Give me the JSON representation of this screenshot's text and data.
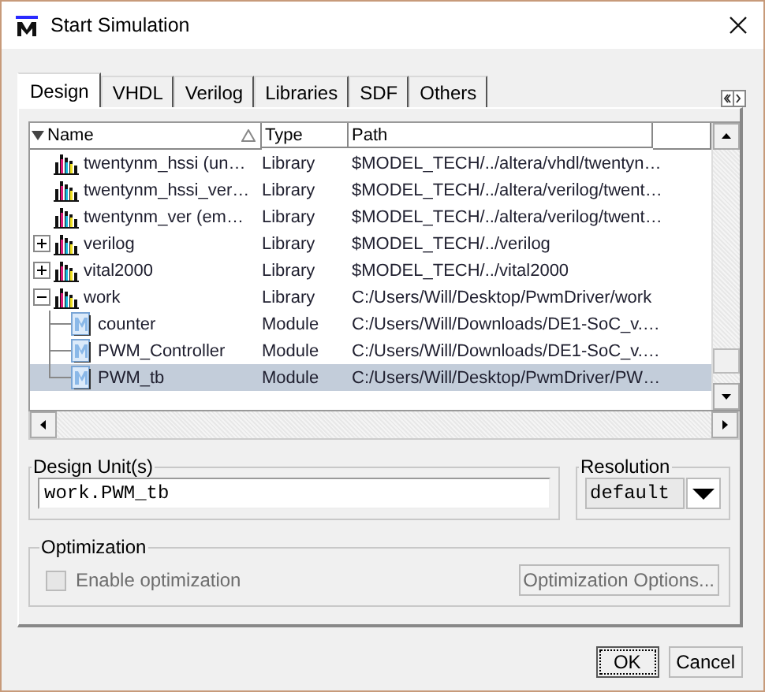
{
  "window": {
    "title": "Start Simulation"
  },
  "tabs": [
    {
      "label": "Design",
      "selected": true
    },
    {
      "label": "VHDL",
      "selected": false
    },
    {
      "label": "Verilog",
      "selected": false
    },
    {
      "label": "Libraries",
      "selected": false
    },
    {
      "label": "SDF",
      "selected": false
    },
    {
      "label": "Others",
      "selected": false
    }
  ],
  "library_tree": {
    "columns": [
      "Name",
      "Type",
      "Path"
    ],
    "items": [
      {
        "kind": "library",
        "name": "twentynm_hssi  (un…",
        "type": "Library",
        "path": "$MODEL_TECH/../altera/vhdl/twentyn…",
        "selected": false
      },
      {
        "kind": "library",
        "name": "twentynm_hssi_ver…",
        "type": "Library",
        "path": "$MODEL_TECH/../altera/verilog/twent…",
        "selected": false
      },
      {
        "kind": "library",
        "name": "twentynm_ver  (em…",
        "type": "Library",
        "path": "$MODEL_TECH/../altera/verilog/twent…",
        "selected": false
      },
      {
        "kind": "library",
        "name": "verilog",
        "type": "Library",
        "path": "$MODEL_TECH/../verilog",
        "selected": false,
        "expanded": false
      },
      {
        "kind": "library",
        "name": "vital2000",
        "type": "Library",
        "path": "$MODEL_TECH/../vital2000",
        "selected": false,
        "expanded": false
      },
      {
        "kind": "library",
        "name": "work",
        "type": "Library",
        "path": "C:/Users/Will/Desktop/PwmDriver/work",
        "selected": false,
        "expanded": true,
        "children": [
          {
            "kind": "module",
            "name": "counter",
            "type": "Module",
            "path": "C:/Users/Will/Downloads/DE1-SoC_v.…",
            "selected": false
          },
          {
            "kind": "module",
            "name": "PWM_Controller",
            "type": "Module",
            "path": "C:/Users/Will/Downloads/DE1-SoC_v.…",
            "selected": false
          },
          {
            "kind": "module",
            "name": "PWM_tb",
            "type": "Module",
            "path": "C:/Users/Will/Desktop/PwmDriver/PW…",
            "selected": true
          }
        ]
      }
    ]
  },
  "design_units": {
    "label": "Design Unit(s)",
    "value": "work.PWM_tb"
  },
  "resolution": {
    "label": "Resolution",
    "value": "default"
  },
  "optimization": {
    "label": "Optimization",
    "checkbox": {
      "label": "Enable optimization",
      "checked": false,
      "disabled": true
    },
    "options_button": {
      "label": "Optimization Options...",
      "disabled": true
    }
  },
  "buttons": [
    {
      "label": "OK",
      "focused": true
    },
    {
      "label": "Cancel",
      "focused": false
    }
  ]
}
